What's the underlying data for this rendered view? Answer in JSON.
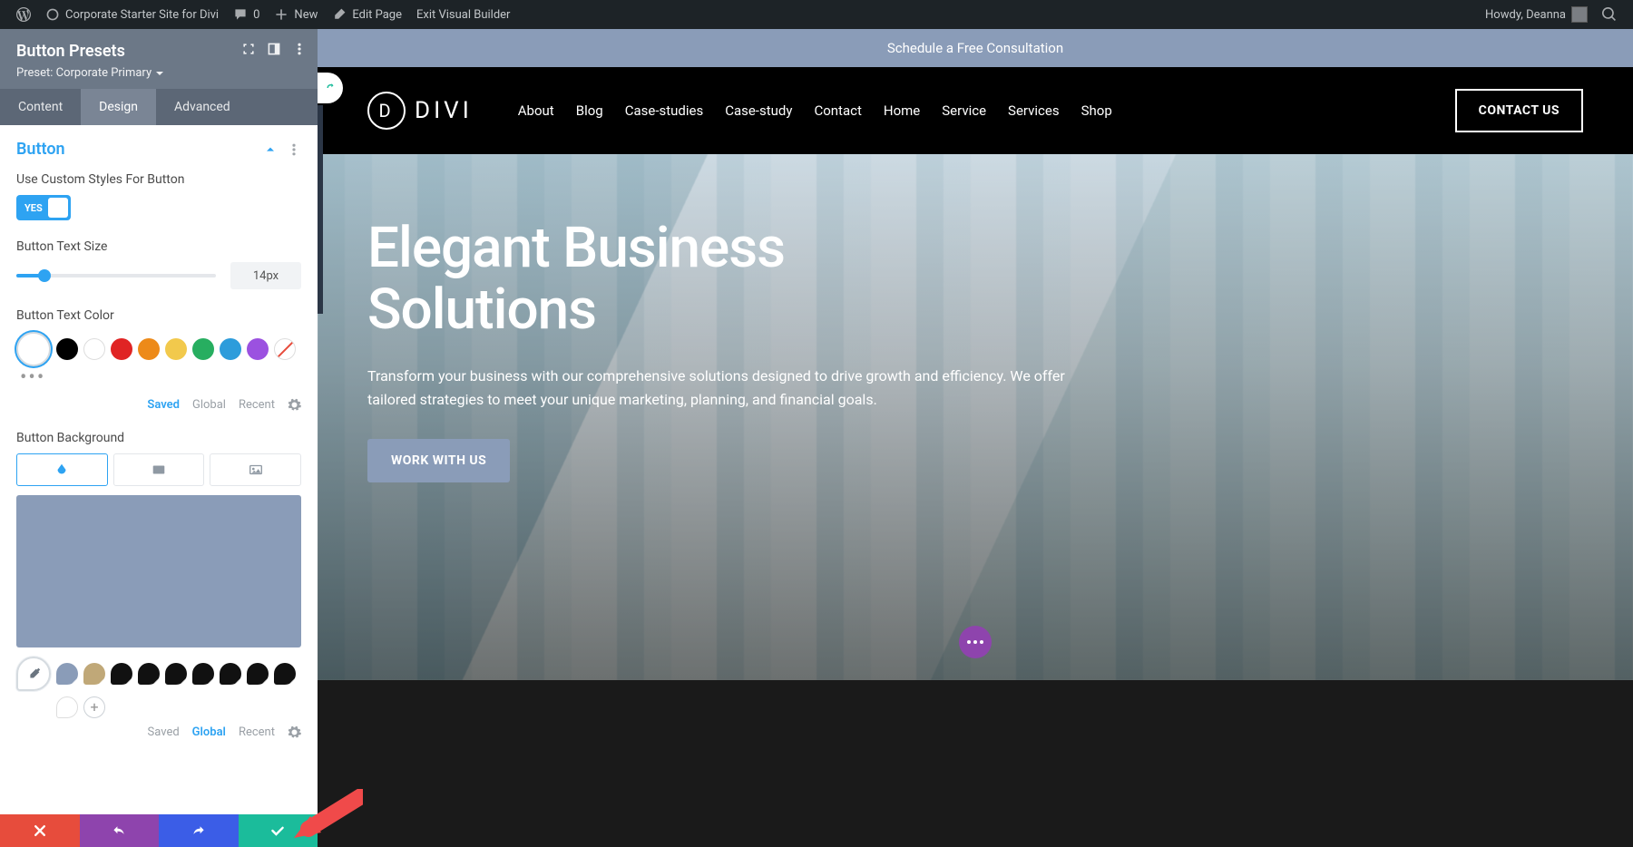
{
  "adminBar": {
    "siteName": "Corporate Starter Site for Divi",
    "comments": "0",
    "new": "New",
    "editPage": "Edit Page",
    "exitVB": "Exit Visual Builder",
    "howdy": "Howdy, Deanna"
  },
  "sidebar": {
    "title": "Button Presets",
    "presetLabel": "Preset: Corporate Primary",
    "tabs": {
      "content": "Content",
      "design": "Design",
      "advanced": "Advanced"
    },
    "section": "Button",
    "opts": {
      "useCustom": "Use Custom Styles For Button",
      "yes": "YES",
      "textSize": "Button Text Size",
      "textSizeVal": "14px",
      "textColor": "Button Text Color",
      "background": "Button Background"
    },
    "paletteTabs": {
      "saved": "Saved",
      "global": "Global",
      "recent": "Recent"
    },
    "colorSwatches": [
      "#000000",
      "#ffffff",
      "#e02424",
      "#ed8a19",
      "#f2c94c",
      "#27ae60",
      "#2d9cdb",
      "#9b51e0"
    ],
    "bgPreview": "#8a9cb8",
    "bgSwatches": [
      "#8a9cb8",
      "#c0a878",
      "#111111",
      "#111111",
      "#111111",
      "#111111",
      "#111111",
      "#111111",
      "#111111"
    ]
  },
  "preview": {
    "bar": "Schedule a Free Consultation",
    "logo": "DIVI",
    "nav": [
      "About",
      "Blog",
      "Case-studies",
      "Case-study",
      "Contact",
      "Home",
      "Service",
      "Services",
      "Shop"
    ],
    "cta": "CONTACT US",
    "heroTitle1": "Elegant Business",
    "heroTitle2": "Solutions",
    "heroText": "Transform your business with our comprehensive solutions designed to drive growth and efficiency. We offer tailored strategies to meet your unique marketing, planning, and financial goals.",
    "heroBtn": "WORK WITH US"
  }
}
